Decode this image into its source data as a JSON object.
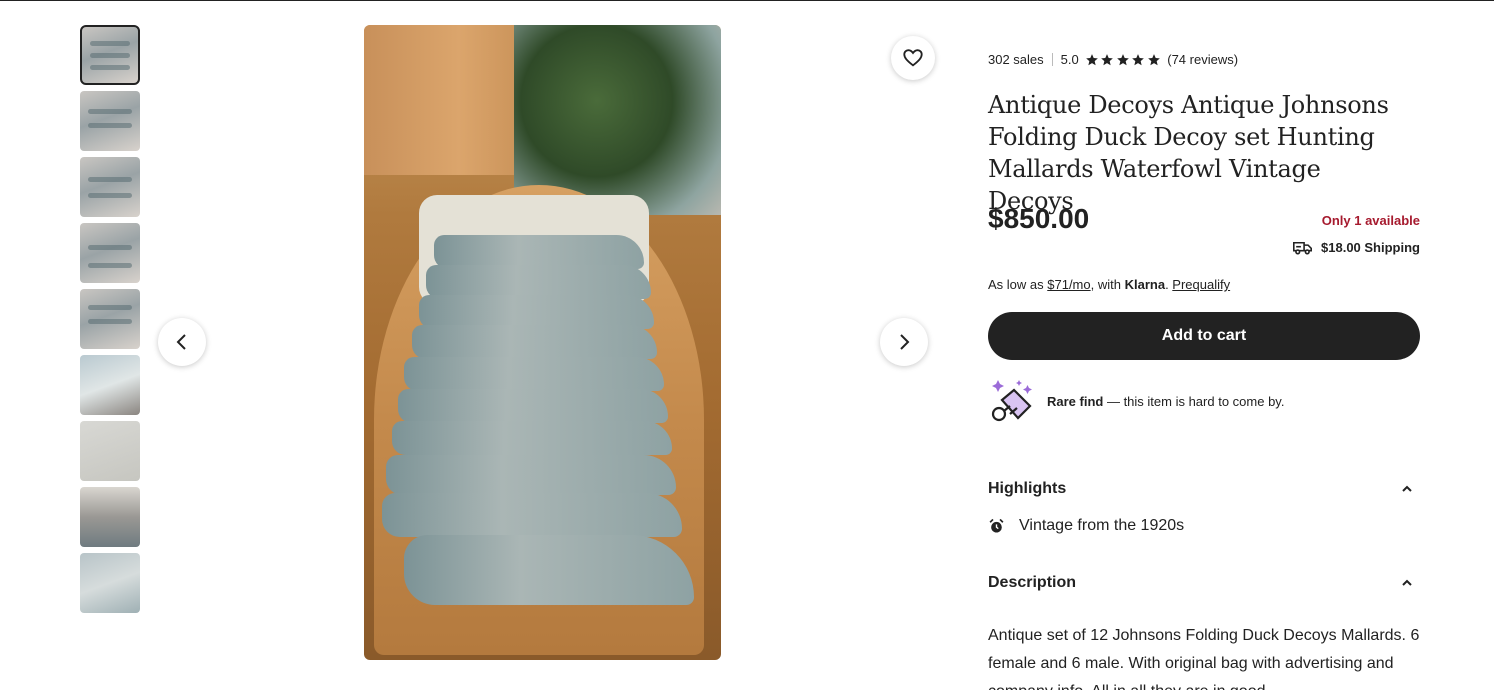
{
  "gallery": {
    "thumbnail_count": 9,
    "active_index": 0
  },
  "listing": {
    "sales": "302 sales",
    "rating": "5.0",
    "reviews": "(74 reviews)",
    "stars": 5,
    "title": "Antique Decoys Antique Johnsons Folding Duck Decoy set Hunting Mallards Waterfowl Vintage Decoys",
    "price": "$850.00",
    "availability": "Only 1 available",
    "shipping": "$18.00 Shipping"
  },
  "klarna": {
    "prefix": "As low as ",
    "amount": "$71/mo",
    "middle": ", with ",
    "brand": "Klarna",
    "dot": ". ",
    "link": "Prequalify"
  },
  "actions": {
    "add_to_cart": "Add to cart"
  },
  "rare": {
    "label": "Rare find",
    "text": " — this item is hard to come by."
  },
  "highlights": {
    "heading": "Highlights",
    "item": "Vintage from the 1920s"
  },
  "description": {
    "heading": "Description",
    "text": "Antique set of 12 Johnsons Folding Duck Decoys Mallards. 6 female and 6 male. With original bag with advertising and company info. All in all they are in good"
  },
  "colors": {
    "accent_dark": "#222222",
    "availability_red": "#a61a2e"
  }
}
